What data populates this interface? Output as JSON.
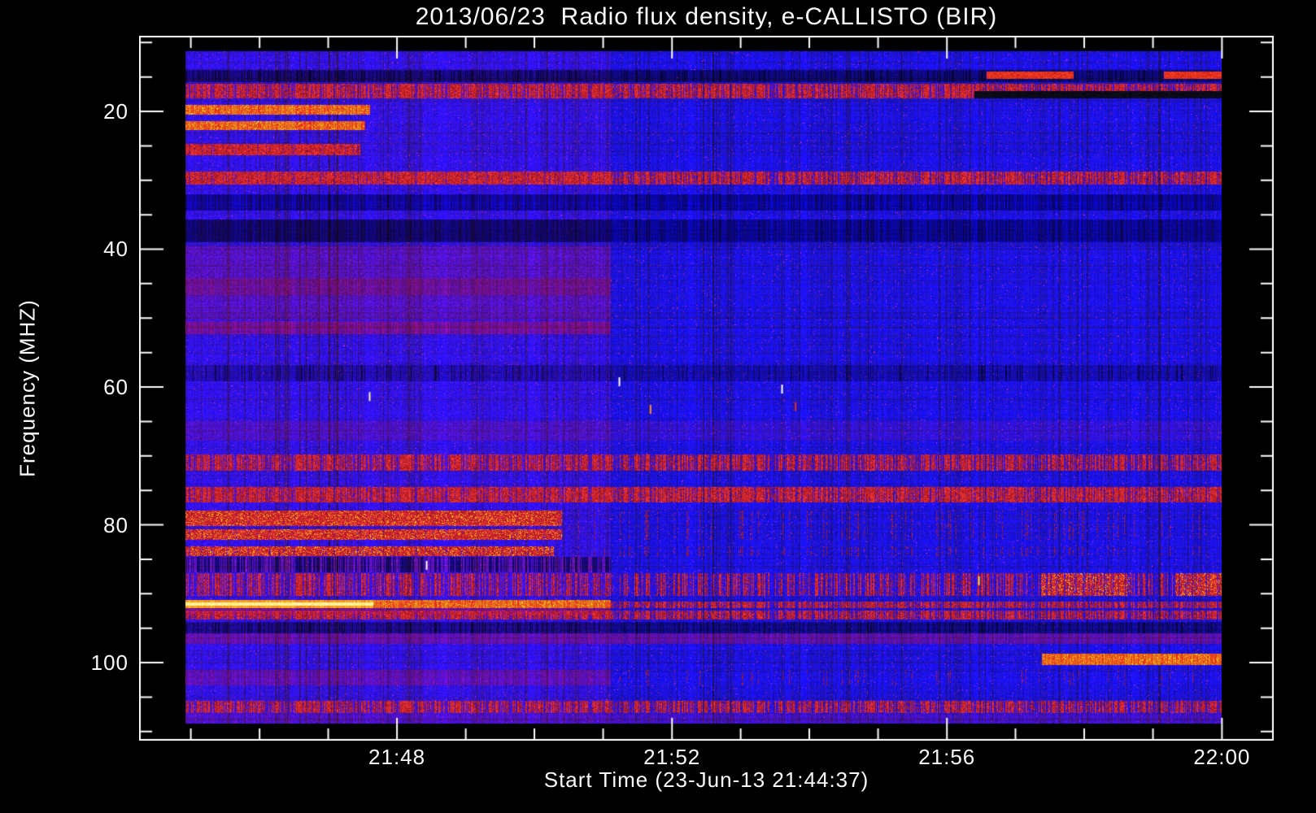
{
  "chart_data": {
    "type": "heatmap",
    "title": "2013/06/23  Radio flux density, e-CALLISTO (BIR)",
    "xlabel": "Start Time (23-Jun-13 21:44:37)",
    "ylabel": "Frequency (MHZ)",
    "x_range": [
      "21:44:37",
      "22:00:00"
    ],
    "y_range_mhz": [
      9,
      111
    ],
    "colormap": "blue-red-yellow radio flux",
    "legend": "none",
    "grid": false,
    "axes_color": "#ffffff",
    "background": "#000000",
    "x_ticks": {
      "major": [
        {
          "frac": 0.2273,
          "label": "21:48"
        },
        {
          "frac": 0.4697,
          "label": "21:52"
        },
        {
          "frac": 0.712,
          "label": "21:56"
        },
        {
          "frac": 0.9544,
          "label": "22:00"
        }
      ],
      "minor_fracs": [
        0.0456,
        0.1062,
        0.1667,
        0.2879,
        0.3484,
        0.409,
        0.5302,
        0.5907,
        0.6513,
        0.7724,
        0.833,
        0.8936
      ]
    },
    "y_ticks": {
      "major": [
        {
          "frac": 0.1073,
          "label": "20"
        },
        {
          "frac": 0.3027,
          "label": "40"
        },
        {
          "frac": 0.4983,
          "label": "60"
        },
        {
          "frac": 0.6938,
          "label": "80"
        },
        {
          "frac": 0.8893,
          "label": "100"
        }
      ],
      "minor_fracs": [
        0.0095,
        0.0584,
        0.1562,
        0.2051,
        0.254,
        0.3516,
        0.4005,
        0.4494,
        0.5472,
        0.5961,
        0.645,
        0.7427,
        0.7916,
        0.8405,
        0.9382,
        0.9871
      ]
    },
    "data_extent_frac": {
      "t0": 0.0409,
      "t1": 0.9544,
      "y0": 0.0219,
      "y1": 0.9758
    },
    "regime_boundary_t": 0.41,
    "palette": {
      "base_blue": "#1d18e8",
      "navy": "#0a0a50",
      "purple": "#6e1e9a",
      "maroon": "#7a1040",
      "red": "#e02010",
      "orange": "#ff8c1e",
      "yellow": "#ffe84a",
      "white_hot": "#fff8d0",
      "black_band": "#020208"
    },
    "bands": [
      {
        "y0": 0.027,
        "y1": 0.045,
        "t0": 0.0,
        "t1": 1.0,
        "fx": "dark",
        "p": 0.75
      },
      {
        "y0": 0.048,
        "y1": 0.069,
        "t0": 0.0,
        "t1": 1.0,
        "fx": "reddash",
        "p": 0.5
      },
      {
        "y0": 0.059,
        "y1": 0.069,
        "t0": 0.761,
        "t1": 1.0,
        "fx": "black",
        "p": 1.0
      },
      {
        "y0": 0.03,
        "y1": 0.04,
        "t0": 0.773,
        "t1": 0.857,
        "fx": "streak",
        "p": 0.9
      },
      {
        "y0": 0.03,
        "y1": 0.04,
        "t0": 0.944,
        "t1": 1.0,
        "fx": "streak",
        "p": 0.8
      },
      {
        "y0": 0.079,
        "y1": 0.094,
        "t0": 0.0,
        "t1": 0.178,
        "fx": "bright",
        "p": 0.92,
        "hot": true
      },
      {
        "y0": 0.103,
        "y1": 0.117,
        "t0": 0.0,
        "t1": 0.173,
        "fx": "bright",
        "p": 0.75,
        "hot": true
      },
      {
        "y0": 0.137,
        "y1": 0.154,
        "t0": 0.0,
        "t1": 0.168,
        "fx": "reddash",
        "p": 0.75
      },
      {
        "y0": 0.178,
        "y1": 0.198,
        "t0": 0.0,
        "t1": 0.41,
        "fx": "reddash",
        "p": 0.68
      },
      {
        "y0": 0.178,
        "y1": 0.198,
        "t0": 0.41,
        "t1": 1.0,
        "fx": "reddash",
        "p": 0.5
      },
      {
        "y0": 0.212,
        "y1": 0.236,
        "t0": 0.0,
        "t1": 1.0,
        "fx": "navy",
        "p": 0.45
      },
      {
        "y0": 0.25,
        "y1": 0.284,
        "t0": 0.0,
        "t1": 0.41,
        "fx": "navy",
        "p": 0.9
      },
      {
        "y0": 0.25,
        "y1": 0.284,
        "t0": 0.41,
        "t1": 1.0,
        "fx": "navy",
        "p": 0.55
      },
      {
        "y0": 0.29,
        "y1": 0.399,
        "t0": 0.0,
        "t1": 0.41,
        "fx": "purple",
        "p": 0.6
      },
      {
        "y0": 0.337,
        "y1": 0.362,
        "t0": 0.0,
        "t1": 0.41,
        "fx": "maroon",
        "p": 0.5
      },
      {
        "y0": 0.401,
        "y1": 0.42,
        "t0": 0.0,
        "t1": 0.41,
        "fx": "maroon",
        "p": 0.8
      },
      {
        "y0": 0.466,
        "y1": 0.49,
        "t0": 0.0,
        "t1": 1.0,
        "fx": "dark",
        "p": 0.35
      },
      {
        "y0": 0.55,
        "y1": 0.579,
        "t0": 0.0,
        "t1": 0.41,
        "fx": "purple",
        "p": 0.45
      },
      {
        "y0": 0.55,
        "y1": 0.579,
        "t0": 0.41,
        "t1": 1.0,
        "fx": "redrow",
        "p": 0.15
      },
      {
        "y0": 0.599,
        "y1": 0.623,
        "t0": 0.0,
        "t1": 1.0,
        "fx": "reddash",
        "p": 0.42
      },
      {
        "y0": 0.647,
        "y1": 0.671,
        "t0": 0.0,
        "t1": 1.0,
        "fx": "reddash",
        "p": 0.55
      },
      {
        "y0": 0.683,
        "y1": 0.706,
        "t0": 0.0,
        "t1": 0.363,
        "fx": "reddash",
        "p": 0.92,
        "hot": true
      },
      {
        "y0": 0.71,
        "y1": 0.726,
        "t0": 0.0,
        "t1": 0.363,
        "fx": "reddash",
        "p": 0.85,
        "hot": true
      },
      {
        "y0": 0.683,
        "y1": 0.726,
        "t0": 0.363,
        "t1": 1.0,
        "fx": "flecks",
        "p": 0.1
      },
      {
        "y0": 0.736,
        "y1": 0.75,
        "t0": 0.0,
        "t1": 0.355,
        "fx": "reddash",
        "p": 0.72,
        "hot": true
      },
      {
        "y0": 0.736,
        "y1": 0.75,
        "t0": 0.355,
        "t1": 1.0,
        "fx": "flecks",
        "p": 0.12
      },
      {
        "y0": 0.752,
        "y1": 0.774,
        "t0": 0.0,
        "t1": 0.41,
        "fx": "darkcols",
        "p": 0.55
      },
      {
        "y0": 0.776,
        "y1": 0.81,
        "t0": 0.0,
        "t1": 1.0,
        "fx": "reddash",
        "p": 0.28
      },
      {
        "y0": 0.776,
        "y1": 0.81,
        "t0": 0.826,
        "t1": 0.912,
        "fx": "reddash",
        "p": 0.55,
        "hot": true
      },
      {
        "y0": 0.776,
        "y1": 0.81,
        "t0": 0.955,
        "t1": 1.0,
        "fx": "reddash",
        "p": 0.6,
        "hot": true
      },
      {
        "y0": 0.816,
        "y1": 0.828,
        "t0": 0.0,
        "t1": 0.181,
        "fx": "yellow",
        "p": 1.0
      },
      {
        "y0": 0.816,
        "y1": 0.828,
        "t0": 0.181,
        "t1": 0.41,
        "fx": "bright",
        "p": 0.85,
        "hot": true
      },
      {
        "y0": 0.818,
        "y1": 0.828,
        "t0": 0.41,
        "t1": 1.0,
        "fx": "reddash",
        "p": 0.45
      },
      {
        "y0": 0.828,
        "y1": 0.838,
        "t0": 0.0,
        "t1": 0.41,
        "fx": "maroon",
        "p": 0.75
      },
      {
        "y0": 0.831,
        "y1": 0.845,
        "t0": 0.0,
        "t1": 1.0,
        "fx": "reddash",
        "p": 0.45
      },
      {
        "y0": 0.848,
        "y1": 0.865,
        "t0": 0.0,
        "t1": 1.0,
        "fx": "dark",
        "p": 0.6
      },
      {
        "y0": 0.865,
        "y1": 0.881,
        "t0": 0.0,
        "t1": 1.0,
        "fx": "maroon",
        "p": 0.6
      },
      {
        "y0": 0.895,
        "y1": 0.912,
        "t0": 0.826,
        "t1": 1.0,
        "fx": "bright",
        "p": 0.9,
        "hot": true
      },
      {
        "y0": 0.92,
        "y1": 0.942,
        "t0": 0.0,
        "t1": 0.41,
        "fx": "maroon",
        "p": 0.55
      },
      {
        "y0": 0.92,
        "y1": 0.942,
        "t0": 0.41,
        "t1": 1.0,
        "fx": "flecks",
        "p": 0.07
      },
      {
        "y0": 0.966,
        "y1": 0.984,
        "t0": 0.0,
        "t1": 1.0,
        "fx": "reddash",
        "p": 0.4
      },
      {
        "y0": 0.985,
        "y1": 1.0,
        "t0": 0.0,
        "t1": 1.0,
        "fx": "maroon",
        "p": 0.35
      }
    ],
    "specks": [
      {
        "t": 0.575,
        "y": 0.502,
        "c": "#ffffff"
      },
      {
        "t": 0.418,
        "y": 0.491,
        "c": "#ffffff"
      },
      {
        "t": 0.177,
        "y": 0.513,
        "c": "#fff0a0"
      },
      {
        "t": 0.448,
        "y": 0.532,
        "c": "#ff9020"
      },
      {
        "t": 0.232,
        "y": 0.764,
        "c": "#ffffff"
      },
      {
        "t": 0.765,
        "y": 0.787,
        "c": "#ffe040"
      },
      {
        "t": 0.588,
        "y": 0.528,
        "c": "#e03010"
      }
    ]
  }
}
